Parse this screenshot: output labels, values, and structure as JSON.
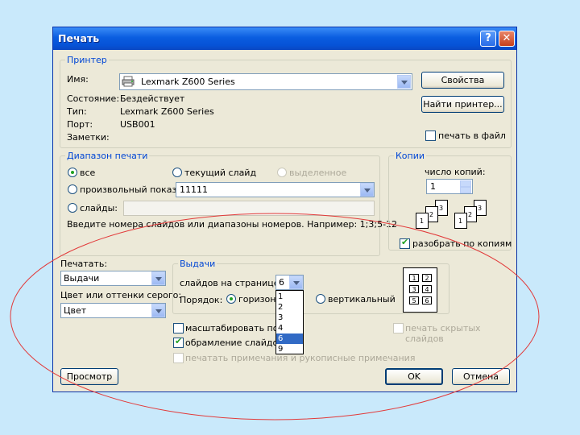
{
  "window": {
    "title": "Печать",
    "help_label": "?",
    "close_label": "✕"
  },
  "printer": {
    "group_title": "Принтер",
    "name_label": "Имя:",
    "name_value": "Lexmark Z600 Series",
    "status_label": "Состояние:",
    "status_value": "Бездействует",
    "type_label": "Тип:",
    "type_value": "Lexmark Z600 Series",
    "port_label": "Порт:",
    "port_value": "USB001",
    "notes_label": "Заметки:",
    "properties_button": "Свойства",
    "find_printer_button": "Найти принтер...",
    "print_to_file_label": "печать в файл"
  },
  "range": {
    "group_title": "Диапазон печати",
    "all_label": "все",
    "current_slide_label": "текущий слайд",
    "selection_label": "выделенное",
    "custom_show_label": "произвольный показ:",
    "custom_show_value": "11111",
    "slides_label": "слайды:",
    "hint": "Введите номера слайдов или диапазоны номеров. Например: 1;3;5-12"
  },
  "copies": {
    "group_title": "Копии",
    "count_label": "число копий:",
    "count_value": "1",
    "collate_label": "разобрать по копиям",
    "sheet_numbers": [
      "1",
      "2",
      "3"
    ]
  },
  "print_what": {
    "label": "Печатать:",
    "value": "Выдачи"
  },
  "color": {
    "label": "Цвет или оттенки серого:",
    "value": "Цвет"
  },
  "handouts": {
    "group_title": "Выдачи",
    "per_page_label": "слайдов на странице:",
    "per_page_value": "6",
    "per_page_options": [
      "1",
      "2",
      "3",
      "4",
      "6",
      "9"
    ],
    "per_page_selected_index": 4,
    "order_label": "Порядок:",
    "horizontal_label": "горизонт",
    "vertical_label": "вертикальный",
    "preview_numbers": [
      "1",
      "2",
      "3",
      "4",
      "5",
      "6"
    ]
  },
  "options": {
    "scale_label": "масштабировать по ли",
    "frame_label": "обрамление слайдов",
    "notes_label": "печатать примечания и рукописные примечания",
    "hidden_slides_label": "печать скрытых слайдов"
  },
  "buttons": {
    "preview": "Просмотр",
    "ok": "OK",
    "cancel": "Отмена"
  },
  "colors": {
    "title_bar": "#0a5de0",
    "group_title": "#0046d5",
    "annotation_ellipse": "#e23a3a"
  }
}
